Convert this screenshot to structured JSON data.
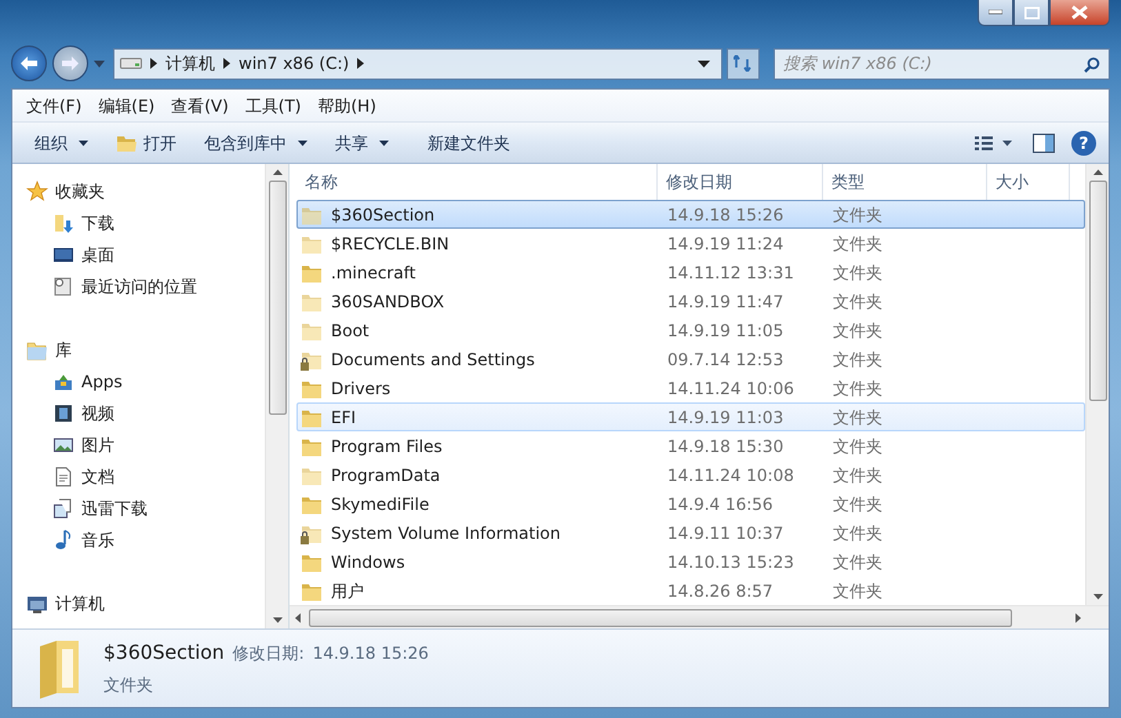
{
  "address_bar": {
    "crumbs": [
      "计算机",
      "win7 x86 (C:)"
    ]
  },
  "search": {
    "placeholder": "搜索 win7 x86 (C:)"
  },
  "menu": [
    "文件(F)",
    "编辑(E)",
    "查看(V)",
    "工具(T)",
    "帮助(H)"
  ],
  "toolbar": [
    {
      "label": "组织",
      "kind": "dropdown"
    },
    {
      "label": "打开",
      "kind": "open"
    },
    {
      "label": "包含到库中",
      "kind": "dropdown"
    },
    {
      "label": "共享",
      "kind": "dropdown"
    },
    {
      "label": "新建文件夹",
      "kind": "plain"
    }
  ],
  "sidebar": {
    "sections": [
      {
        "label": "收藏夹",
        "items": [
          "下载",
          "桌面",
          "最近访问的位置"
        ]
      },
      {
        "label": "库",
        "items": [
          "Apps",
          "视频",
          "图片",
          "文档",
          "迅雷下载",
          "音乐"
        ]
      },
      {
        "label": "计算机"
      }
    ]
  },
  "help_button": "?",
  "table": {
    "columns": [
      "名称",
      "修改日期",
      "类型",
      "大小"
    ],
    "rows": [
      {
        "name": "$360Section",
        "date": "14.9.18 15:26",
        "type": "文件夹",
        "selected": true,
        "hovered": false,
        "hidden": true,
        "locked": false
      },
      {
        "name": "$RECYCLE.BIN",
        "date": "14.9.19 11:24",
        "type": "文件夹",
        "selected": false,
        "hovered": false,
        "hidden": true,
        "locked": false
      },
      {
        "name": ".minecraft",
        "date": "14.11.12 13:31",
        "type": "文件夹",
        "selected": false,
        "hovered": false,
        "hidden": false,
        "locked": false
      },
      {
        "name": "360SANDBOX",
        "date": "14.9.19 11:47",
        "type": "文件夹",
        "selected": false,
        "hovered": false,
        "hidden": true,
        "locked": false
      },
      {
        "name": "Boot",
        "date": "14.9.19 11:05",
        "type": "文件夹",
        "selected": false,
        "hovered": false,
        "hidden": true,
        "locked": false
      },
      {
        "name": "Documents and Settings",
        "date": "09.7.14 12:53",
        "type": "文件夹",
        "selected": false,
        "hovered": false,
        "hidden": true,
        "locked": true
      },
      {
        "name": "Drivers",
        "date": "14.11.24 10:06",
        "type": "文件夹",
        "selected": false,
        "hovered": false,
        "hidden": false,
        "locked": false
      },
      {
        "name": "EFI",
        "date": "14.9.19 11:03",
        "type": "文件夹",
        "selected": false,
        "hovered": true,
        "hidden": false,
        "locked": false
      },
      {
        "name": "Program Files",
        "date": "14.9.18 15:30",
        "type": "文件夹",
        "selected": false,
        "hovered": false,
        "hidden": false,
        "locked": false
      },
      {
        "name": "ProgramData",
        "date": "14.11.24 10:08",
        "type": "文件夹",
        "selected": false,
        "hovered": false,
        "hidden": true,
        "locked": false
      },
      {
        "name": "SkymediFile",
        "date": "14.9.4 16:56",
        "type": "文件夹",
        "selected": false,
        "hovered": false,
        "hidden": false,
        "locked": false
      },
      {
        "name": "System Volume Information",
        "date": "14.9.11 10:37",
        "type": "文件夹",
        "selected": false,
        "hovered": false,
        "hidden": true,
        "locked": true
      },
      {
        "name": "Windows",
        "date": "14.10.13 15:23",
        "type": "文件夹",
        "selected": false,
        "hovered": false,
        "hidden": false,
        "locked": false
      },
      {
        "name": "用户",
        "date": "14.8.26 8:57",
        "type": "文件夹",
        "selected": false,
        "hovered": false,
        "hidden": false,
        "locked": false
      }
    ]
  },
  "details": {
    "name": "$360Section",
    "date_label": "修改日期:",
    "date": "14.9.18 15:26",
    "type": "文件夹"
  }
}
